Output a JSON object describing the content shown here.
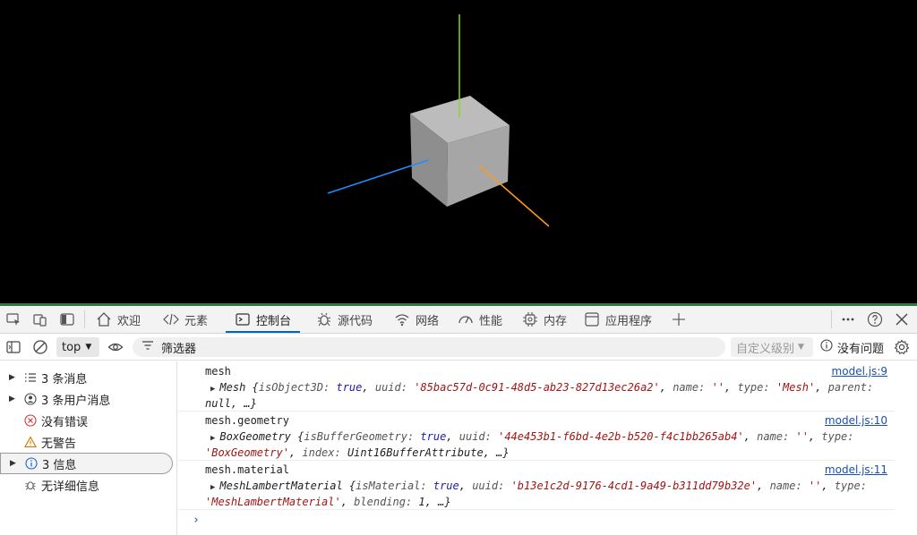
{
  "toolbar_tabs": [
    {
      "label": "欢迎",
      "icon": "home-icon"
    },
    {
      "label": "元素",
      "icon": "code-icon"
    },
    {
      "label": "控制台",
      "icon": "console-icon",
      "active": true
    },
    {
      "label": "源代码",
      "icon": "bug-icon"
    },
    {
      "label": "网络",
      "icon": "wifi-icon"
    },
    {
      "label": "性能",
      "icon": "gauge-icon"
    },
    {
      "label": "内存",
      "icon": "chip-icon"
    },
    {
      "label": "应用程序",
      "icon": "app-window-icon"
    }
  ],
  "console_toolbar": {
    "context": "top",
    "filter_placeholder": "筛选器",
    "levels": "自定义级别",
    "issues": "没有问题"
  },
  "sidebar": [
    {
      "label": "3 条消息",
      "icon": "list-icon",
      "expandable": true
    },
    {
      "label": "3 条用户消息",
      "icon": "user-icon",
      "expandable": true
    },
    {
      "label": "没有错误",
      "icon": "error-icon",
      "expandable": false
    },
    {
      "label": "无警告",
      "icon": "warning-icon",
      "expandable": false
    },
    {
      "label": "3 信息",
      "icon": "info-icon",
      "expandable": true,
      "selected": true
    },
    {
      "label": "无详细信息",
      "icon": "bug-icon",
      "expandable": false
    }
  ],
  "messages": [
    {
      "label": "mesh",
      "source": "model.js:9",
      "class": "Mesh",
      "props": [
        {
          "k": "isObject3D",
          "v": "true",
          "type": "bool"
        },
        {
          "k": "uuid",
          "v": "'85bac57d-0c91-48d5-ab23-827d13ec26a2'",
          "type": "str"
        },
        {
          "k": "name",
          "v": "''",
          "type": "str"
        },
        {
          "k": "type",
          "v": "'Mesh'",
          "type": "str"
        },
        {
          "k": "parent",
          "v": "null",
          "type": "plain"
        }
      ],
      "tail": "…}"
    },
    {
      "label": "mesh.geometry",
      "source": "model.js:10",
      "class": "BoxGeometry",
      "props": [
        {
          "k": "isBufferGeometry",
          "v": "true",
          "type": "bool"
        },
        {
          "k": "uuid",
          "v": "'44e453b1-f6bd-4e2b-b520-f4c1bb265ab4'",
          "type": "str"
        },
        {
          "k": "name",
          "v": "''",
          "type": "str"
        },
        {
          "k": "type",
          "v": "'BoxGeometry'",
          "type": "str"
        },
        {
          "k": "index",
          "v": "Uint16BufferAttribute",
          "type": "plain"
        }
      ],
      "tail": "…}"
    },
    {
      "label": "mesh.material",
      "source": "model.js:11",
      "class": "MeshLambertMaterial",
      "props": [
        {
          "k": "isMaterial",
          "v": "true",
          "type": "bool"
        },
        {
          "k": "uuid",
          "v": "'b13e1c2d-9176-4cd1-9a49-b311dd79b32e'",
          "type": "str"
        },
        {
          "k": "name",
          "v": "''",
          "type": "str"
        },
        {
          "k": "type",
          "v": "'MeshLambertMaterial'",
          "type": "str"
        },
        {
          "k": "blending",
          "v": "1",
          "type": "plain"
        }
      ],
      "tail": "…}"
    }
  ],
  "prompt_symbol": "›",
  "colors": {
    "accent": "#0067c0",
    "string": "#a31515",
    "keyword": "#1a1aa6",
    "link": "#1a4fb0"
  }
}
